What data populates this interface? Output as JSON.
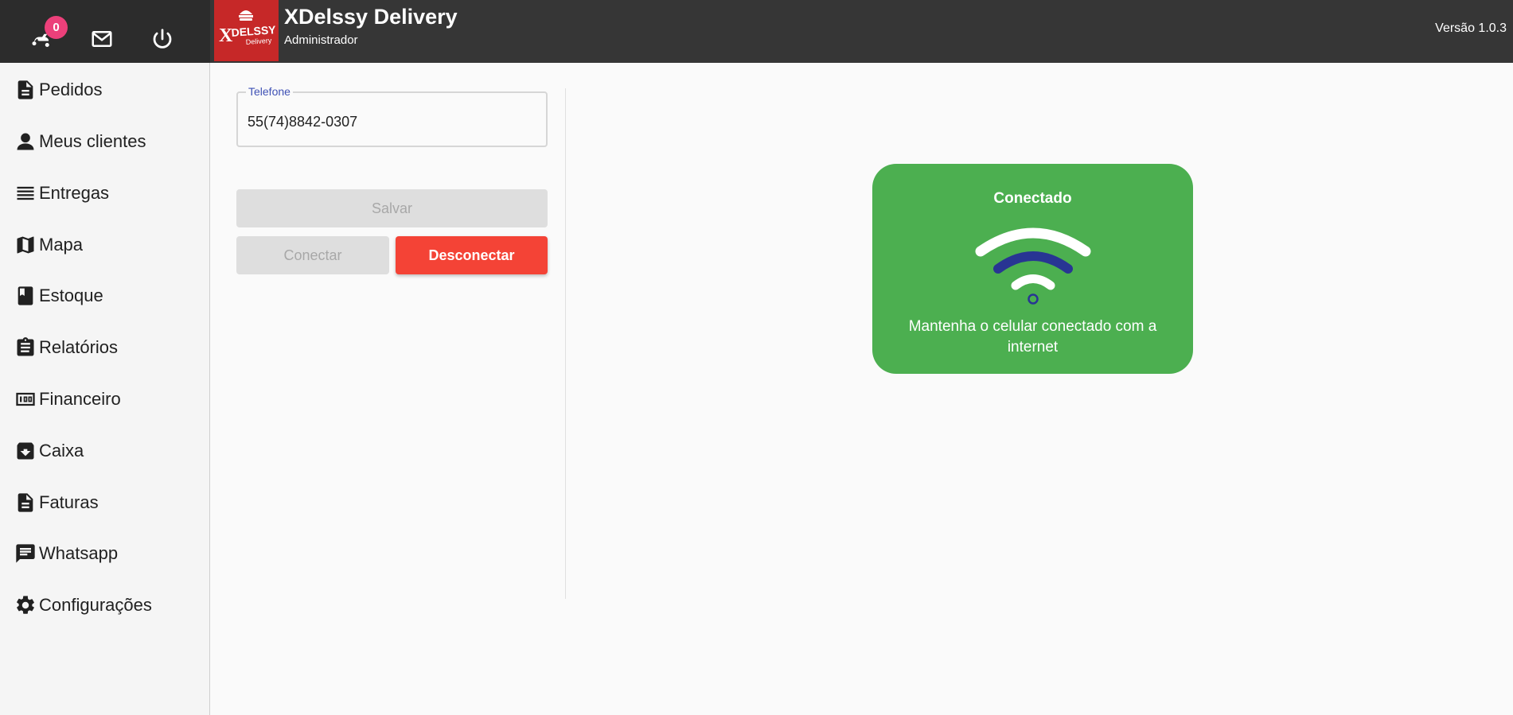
{
  "header": {
    "title": "XDelssy Delivery",
    "subtitle": "Administrador",
    "version": "Versão 1.0.3",
    "notification_count": "0",
    "logo_text": "XDELSSY Delivery"
  },
  "sidebar": {
    "items": [
      {
        "label": "Pedidos",
        "icon": "document-icon"
      },
      {
        "label": "Meus clientes",
        "icon": "person-icon"
      },
      {
        "label": "Entregas",
        "icon": "list-icon"
      },
      {
        "label": "Mapa",
        "icon": "map-icon"
      },
      {
        "label": "Estoque",
        "icon": "book-icon"
      },
      {
        "label": "Relatórios",
        "icon": "clipboard-icon"
      },
      {
        "label": "Financeiro",
        "icon": "money-icon"
      },
      {
        "label": "Caixa",
        "icon": "archive-icon"
      },
      {
        "label": "Faturas",
        "icon": "invoice-icon"
      },
      {
        "label": "Whatsapp",
        "icon": "chat-icon"
      },
      {
        "label": "Configurações",
        "icon": "gear-icon"
      }
    ]
  },
  "form": {
    "phone_label": "Telefone",
    "phone_value": "55(74)8842-0307",
    "save_label": "Salvar",
    "connect_label": "Conectar",
    "disconnect_label": "Desconectar"
  },
  "status": {
    "title": "Conectado",
    "message": "Mantenha o celular conectado com a internet"
  },
  "colors": {
    "topbar": "#363636",
    "status_card": "#4caf50",
    "disconnect": "#f44336",
    "badge": "#ec407a",
    "field_label": "#3f51b5"
  }
}
